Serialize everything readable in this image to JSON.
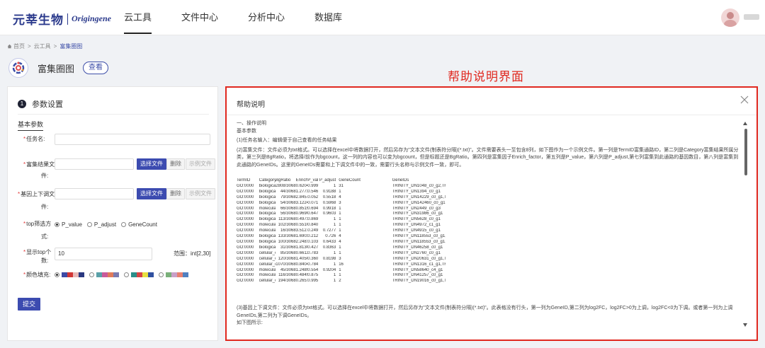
{
  "header": {
    "logo_cn": "元莘生物",
    "logo_en": "Origingene",
    "nav": [
      {
        "label": "云工具",
        "active": true
      },
      {
        "label": "文件中心",
        "active": false
      },
      {
        "label": "分析中心",
        "active": false
      },
      {
        "label": "数据库",
        "active": false
      }
    ]
  },
  "breadcrumb": {
    "items": [
      "首页",
      "云工具",
      "富集圈图"
    ],
    "separator": ">"
  },
  "page": {
    "title": "富集圈图",
    "view_button": "查看"
  },
  "annotation": "帮助说明界面",
  "form": {
    "step_number": "1",
    "section_title": "参数设置",
    "subsection": "基本参数",
    "task_name": {
      "label": "任务名:",
      "value": ""
    },
    "enrich_file": {
      "label": "富集结果文",
      "label_cont": "件:",
      "choose": "选择文件",
      "delete": "删除",
      "example": "示例文件"
    },
    "gene_file": {
      "label": "基因上下调文",
      "label_cont": "件:",
      "choose": "选择文件",
      "delete": "删除",
      "example": "示例文件"
    },
    "top_method": {
      "label": "top筛选方",
      "label_cont": "式:",
      "options": [
        "P_value",
        "P_adjust",
        "GeneCount"
      ],
      "selected": 0
    },
    "top_n": {
      "label": "显示top个",
      "label_cont": "数:",
      "value": "10",
      "range": "范围：int[2,30]"
    },
    "color_fill": {
      "label": "颜色填充:",
      "selected": 0,
      "palettes": [
        [
          "#3d4aa5",
          "#d13535",
          "#e8b8b8",
          "#2a3880"
        ],
        [
          "#5aa0a8",
          "#c95a9a",
          "#e07a5a",
          "#7a7ab0"
        ],
        [
          "#2b8f8a",
          "#d64545",
          "#e8e040",
          "#3050a0"
        ],
        [
          "#7ab07a",
          "#c8a0c8",
          "#e88070",
          "#5080c0"
        ]
      ]
    },
    "submit": "提交"
  },
  "help": {
    "title": "帮助说明",
    "heading": "一、操作说明",
    "subheading": "基本参数",
    "para1": "(1)任务名输入：编辑便于自己查看的任务结果",
    "para2": "(2)富集文件：文件必须为txt格式。可以选择在excel中将数据打开，然后另存为\"文本文件(制表符分隔)(*.txt)\"。文件需要表头一至包含8列，如下图作为一个示例文件。第一列是TermID富集通路ID，第二列是Category富集结果所属分类，第三列是BgRatio，将选择/前作为bgcount，这一列的内容也可以变为bgcount，但是标题还是BgRatio。第四列是富集因子Enrich_factor，第五列是P_value，第六列是P_adjust,第七列富集到此通路的基因数目，第八列是富集到此通路的GeneIDs。这里的GeneIDs需要和上下调文件中的一致，需要行头名称与示例文件一致，即可。",
    "table": {
      "header": [
        "TermID",
        "Category",
        "BgRatio",
        "Enrich_factor",
        "P_value",
        "P_adjust",
        "GeneCount",
        "GeneIDs"
      ],
      "rows": [
        [
          "GO:0000",
          "biological",
          "2808/3068",
          "0.62047799",
          "0.999",
          "1",
          "31",
          "TRINITY_DN1048_c0_g2,TRI"
        ],
        [
          "GO:0000",
          "biological",
          "44/3068",
          "1.27734765",
          "0.5464",
          "0.9188",
          "1",
          "TRINITY_DN1394_c0_g1"
        ],
        [
          "GO:0000",
          "biological",
          "79/3068",
          "2.84573654",
          "0.0525",
          "0.5518",
          "4",
          "TRINITY_DN14229_c0_g1,TR"
        ],
        [
          "GO:0000",
          "biological",
          "54/3068",
          "3.12240537",
          "0.0714",
          "0.5968",
          "3",
          "TRINITY_DN142460_c0_g1,T"
        ],
        [
          "GO:0000",
          "molecular",
          "66/3068",
          "0.8515651",
          "0.6946",
          "0.9918",
          "1",
          "TRINITY_DN2449_c0_g3"
        ],
        [
          "GO:0000",
          "biological",
          "56/3068",
          "0.96902236",
          "0.6473",
          "0.9603",
          "1",
          "TRINITY_DN31986_c0_g1"
        ],
        [
          "GO:0000",
          "biological",
          "113/3068",
          "0.49737431",
          "0.869",
          "1",
          "1",
          "TRINITY_DN5628_c0_g1"
        ],
        [
          "GO:0000",
          "molecular",
          "102/3068",
          "0.55101271",
          "0.8403",
          "1",
          "1",
          "TRINITY_DN4972_c1_g1"
        ],
        [
          "GO:0000",
          "molecular",
          "16/3068",
          "3.51270604",
          "0.2497",
          "0.7277",
          "1",
          "TRINITY_DN4915_c0_g1"
        ],
        [
          "GO:0000",
          "biological",
          "133/3068",
          "1.69032471",
          "0.2128",
          "0.726",
          "4",
          "TRINITY_DN118553_c0_g1,T"
        ],
        [
          "GO:0000",
          "biological",
          "100/3068",
          "2.24813187",
          "0.1033",
          "0.6433",
          "4",
          "TRINITY_DN118553_c0_g1,T"
        ],
        [
          "GO:0000",
          "biological",
          "31/3068",
          "1.81300957",
          "0.427",
          "0.8363",
          "1",
          "TRINITY_DN46258_c0_g1"
        ],
        [
          "GO:0000",
          "cellular_c",
          "85/3068",
          "0.66121526",
          "0.7831",
          "1",
          "1",
          "TRINITY_DN2760_c0_g1"
        ],
        [
          "GO:0000",
          "cellular_c",
          "120/3068",
          "1.40508242",
          "0.3602",
          "0.8198",
          "3",
          "TRINITY_DN20631_c0_g1,TR"
        ],
        [
          "GO:0000",
          "cellular_c",
          "1070/3068",
          "0.84042313",
          "0.7846",
          "1",
          "16",
          "TRINITY_DN1316_c1_g1,TRI"
        ],
        [
          "GO:0000",
          "molecular",
          "45/3068",
          "1.24896215",
          "0.5545",
          "0.9204",
          "1",
          "TRINITY_DN58640_c4_g1"
        ],
        [
          "GO:0000",
          "molecular",
          "116/3068",
          "0.48451118",
          "0.8759",
          "1",
          "1",
          "TRINITY_DN41257_c0_g1"
        ],
        [
          "GO:0000",
          "cellular_c",
          "194/3068",
          "0.26519969",
          "0.9959",
          "1",
          "2",
          "TRINITY_DN19016_c0_g1,TR"
        ]
      ]
    },
    "para3": "(3)基因上下调文件：文件必须为txt格式。可以选择在excel中将数据打开，然后另存为\"文本文件(制表符分隔)(*.txt)\"。此表格没有行头，第一列为GeneID,第二列为log2FC，log2FC>0为上调，log2FC<0为下调。或者第一列为上调GeneIDs,第二列为下调GeneIDs。",
    "para4": "如下图所示:"
  }
}
